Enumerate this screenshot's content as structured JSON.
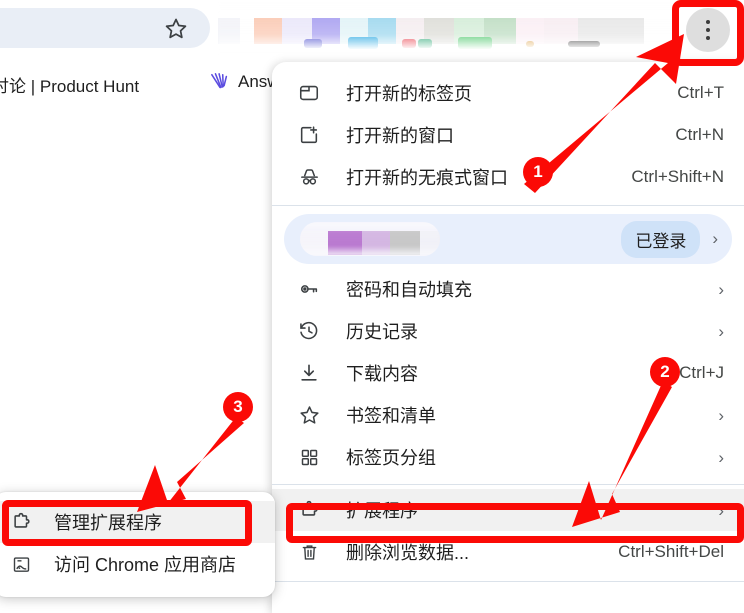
{
  "browser": {
    "omnibox": {
      "value": "",
      "placeholder": ""
    },
    "star_icon_name": "bookmark-star-icon",
    "menu_button_title": "⠇",
    "bookmarks": [
      {
        "label": "讨论 | Product Hunt",
        "icon": ""
      },
      {
        "label": "Answ",
        "icon": "anthropic-icon"
      }
    ],
    "extension_strip_colors": [
      "#fbc7b0",
      "#e9e6fa",
      "#a59cf0",
      "#e0f3f7",
      "#9ad6ee",
      "#f4ecef",
      "#dcdcd6",
      "#d2ecd6",
      "#bcdcc0",
      "#fbeef4",
      "#f7ecf1",
      "#e6e6e6"
    ]
  },
  "menu": {
    "sections": [
      {
        "items": [
          {
            "icon": "new-tab-icon",
            "label": "打开新的标签页",
            "accel": "Ctrl+T",
            "chevron": ""
          },
          {
            "icon": "new-window-icon",
            "label": "打开新的窗口",
            "accel": "Ctrl+N",
            "chevron": ""
          },
          {
            "icon": "incognito-icon",
            "label": "打开新的无痕式窗口",
            "accel": "Ctrl+Shift+N",
            "chevron": ""
          }
        ]
      },
      {
        "items": [
          {
            "icon": "key-icon",
            "label": "密码和自动填充",
            "accel": "",
            "chevron": "›"
          },
          {
            "icon": "history-icon",
            "label": "历史记录",
            "accel": "",
            "chevron": "›"
          },
          {
            "icon": "download-icon",
            "label": "下载内容",
            "accel": "Ctrl+J",
            "chevron": ""
          },
          {
            "icon": "star-icon",
            "label": "书签和清单",
            "accel": "",
            "chevron": "›"
          },
          {
            "icon": "tab-groups-icon",
            "label": "标签页分组",
            "accel": "",
            "chevron": "›"
          }
        ]
      },
      {
        "items": [
          {
            "icon": "puzzle-icon",
            "label": "扩展程序",
            "accel": "",
            "chevron": "›",
            "highlighted": true
          },
          {
            "icon": "trash-icon",
            "label": "删除浏览数据...",
            "accel": "Ctrl+Shift+Del",
            "chevron": ""
          }
        ]
      }
    ],
    "profile": {
      "name": "",
      "status_badge": "已登录",
      "chevron": "›",
      "avatar_colors": [
        "#f7f6fb",
        "#a855c4",
        "#c9a3db",
        "#b9b9b9",
        "#ececf4"
      ]
    }
  },
  "submenu": {
    "items": [
      {
        "icon": "puzzle-icon",
        "label": "管理扩展程序",
        "highlighted": true
      },
      {
        "icon": "webstore-icon",
        "label": "访问 Chrome 应用商店",
        "highlighted": false
      }
    ]
  },
  "annotations": {
    "accent_color": "#fb0a06",
    "badges": [
      {
        "number": "1"
      },
      {
        "number": "2"
      },
      {
        "number": "3"
      }
    ]
  }
}
